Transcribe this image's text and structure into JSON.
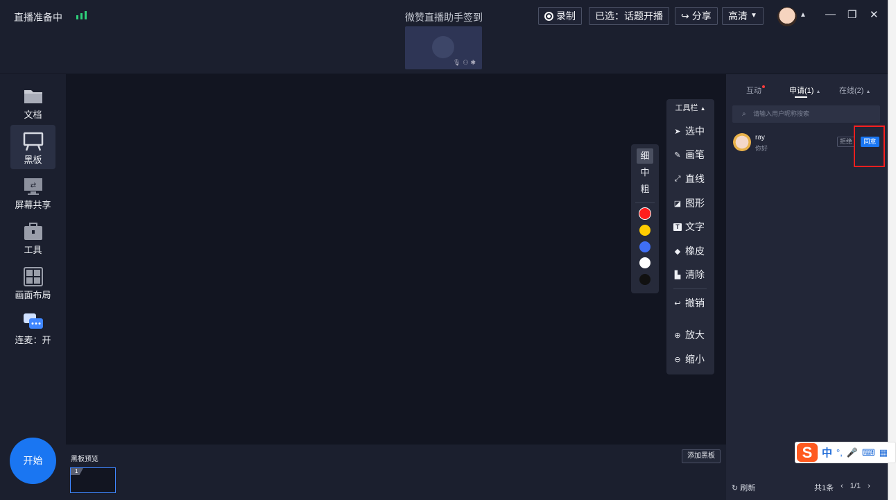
{
  "titlebar": {
    "status": "直播准备中",
    "center_title": "微赞直播助手签到",
    "record_label": "录制",
    "selected_label": "已选：话题开播",
    "share_label": "分享",
    "quality_label": "高清"
  },
  "sidebar": {
    "items": [
      {
        "label": "文档",
        "icon": "folder-icon"
      },
      {
        "label": "黑板",
        "icon": "blackboard-icon"
      },
      {
        "label": "屏幕共享",
        "icon": "screen-share-icon"
      },
      {
        "label": "工具",
        "icon": "toolbox-icon"
      },
      {
        "label": "画面布局",
        "icon": "layout-icon"
      },
      {
        "label": "连麦：开",
        "icon": "chat-bubble-icon"
      }
    ],
    "start_label": "开始"
  },
  "pen_panel": {
    "thickness": [
      "细",
      "中",
      "粗"
    ],
    "selected_thickness": "细",
    "colors": [
      "#ff1d1d",
      "#ffcc00",
      "#3f6ff5",
      "#ffffff",
      "#111111"
    ],
    "selected_color": "#ff1d1d"
  },
  "toolbar": {
    "header": "工具栏",
    "tools": [
      {
        "label": "选中",
        "icon": "cursor-icon"
      },
      {
        "label": "画笔",
        "icon": "pen-icon"
      },
      {
        "label": "直线",
        "icon": "line-icon"
      },
      {
        "label": "图形",
        "icon": "shape-icon"
      },
      {
        "label": "文字",
        "icon": "text-icon"
      },
      {
        "label": "橡皮",
        "icon": "eraser-icon"
      },
      {
        "label": "清除",
        "icon": "clear-icon"
      },
      {
        "label": "撤销",
        "icon": "undo-icon"
      },
      {
        "label": "放大",
        "icon": "zoom-in-icon"
      },
      {
        "label": "缩小",
        "icon": "zoom-out-icon"
      }
    ]
  },
  "board_preview": {
    "label": "黑板预览",
    "add_label": "添加黑板",
    "thumb_number": "1"
  },
  "right_panel": {
    "tabs": [
      {
        "label": "互动",
        "badge": true
      },
      {
        "label": "申请(1)",
        "active": true
      },
      {
        "label": "在线(2)"
      }
    ],
    "search_placeholder": "请输入用户昵称搜索",
    "requests": [
      {
        "name": "ray",
        "message": "你好",
        "reject_label": "拒绝",
        "agree_label": "同意"
      }
    ],
    "refresh_label": "刷新",
    "total_label": "共1条",
    "page_label": "1/1"
  },
  "ime": {
    "logo": "S",
    "mode": "中",
    "punct": "°,"
  },
  "colors": {
    "accent": "#1a76f2",
    "background": "#1b1f2e",
    "canvas": "#121521",
    "highlight": "#ff1f1f"
  }
}
